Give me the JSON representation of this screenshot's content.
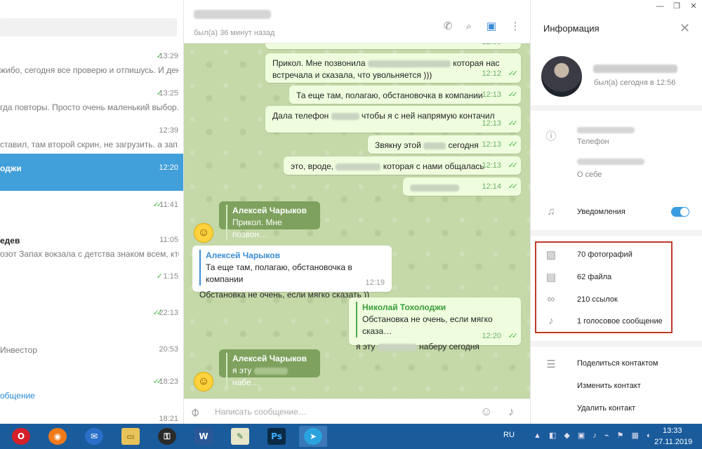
{
  "window_controls": [
    "—",
    "❐",
    "✕"
  ],
  "chat_list": [
    {
      "time": "13:29",
      "preview": "жибо, сегодня все проверю и отпишусь. И дене…",
      "read": true
    },
    {
      "time": "13:25",
      "preview": "гда повторы. Просто очень маленький выбор. И…",
      "read": true
    },
    {
      "time": "12:39",
      "preview": "ставил, там второй скрин, не загрузить. а зап…",
      "read": false
    },
    {
      "name": "оджи",
      "time": "12:20",
      "preview": "",
      "active": true
    },
    {
      "time": "11:41",
      "preview": "",
      "read": true
    },
    {
      "name": "едев",
      "time": "11:05",
      "preview": "озот  Запах вокзала с детства знаком всем, кто …"
    },
    {
      "time": "1:15",
      "preview": "",
      "read": true
    },
    {
      "time": "22:13",
      "preview": "",
      "read": true
    },
    {
      "name": "Инвестор",
      "time": "20:53",
      "preview": ""
    },
    {
      "time": "18:23",
      "preview": "общение",
      "read": true,
      "link": true
    },
    {
      "time": "18:21",
      "preview": ""
    }
  ],
  "chat": {
    "status": "был(а) 36 минут назад",
    "messages": [
      {
        "text_a": "Прикол. Мне позвонила",
        "text_b": "которая нас встречала и сказала, что увольняется )))",
        "time": "12:12"
      },
      {
        "text": "Та еще там, полагаю, обстановочка в компании",
        "time": "12:13"
      },
      {
        "text_a": "Дала телефон",
        "text_b": "чтобы я с ней напрямую контачил",
        "time": "12:13"
      },
      {
        "text_a": "Звякну этой",
        "text_b": "сегодня",
        "time": "12:13"
      },
      {
        "text_a": "это, вроде,",
        "text_b": "которая с нами общалась",
        "time": "12:13"
      },
      {
        "text": "",
        "time": "12:14"
      }
    ],
    "forward1": {
      "name": "Алексей Чарыков",
      "text": "Прикол. Мне позвон…"
    },
    "incoming": {
      "reply_name": "Алексей Чарыков",
      "reply_text": "Та еще там, полагаю, обстановочка в компании",
      "text": "Обстановка не очень, если мягко сказать ))",
      "time": "12:19"
    },
    "outgoing": {
      "reply_name": "Николай Тохолоджи",
      "reply_text": "Обстановка не очень, если мягко сказа…",
      "text_a": "я эту",
      "text_b": "наберу сегодня",
      "time": "12:20"
    },
    "forward2": {
      "name": "Алексей Чарыков",
      "text_a": "я эту",
      "text_b": "набе…"
    },
    "composer_placeholder": "Написать сообщение…"
  },
  "info": {
    "title": "Информация",
    "status": "был(а) сегодня в 12:56",
    "phone_label": "Телефон",
    "about_label": "О себе",
    "notifications_label": "Уведомления",
    "notifications_on": true,
    "media": {
      "photos": "70 фотографий",
      "files": "62 файла",
      "links": "210 ссылок",
      "voice": "1 голосовое сообщение"
    },
    "actions": {
      "share": "Поделиться контактом",
      "edit": "Изменить контакт",
      "delete": "Удалить контакт"
    }
  },
  "taskbar": {
    "apps": [
      "opera",
      "firefox",
      "thunderbird",
      "explorer",
      "keepass",
      "word",
      "notepad",
      "photoshop",
      "telegram"
    ],
    "app_labels": {
      "word": "W",
      "photoshop": "Ps"
    },
    "lang": "RU",
    "time": "13:33",
    "date": "27.11.2019"
  },
  "colors": {
    "active_chat": "#419fd9",
    "bubble_out": "#effdde",
    "chat_bg": "#c4d8a8",
    "highlight": "#c0392b",
    "taskbar": "#1a5b9c"
  }
}
